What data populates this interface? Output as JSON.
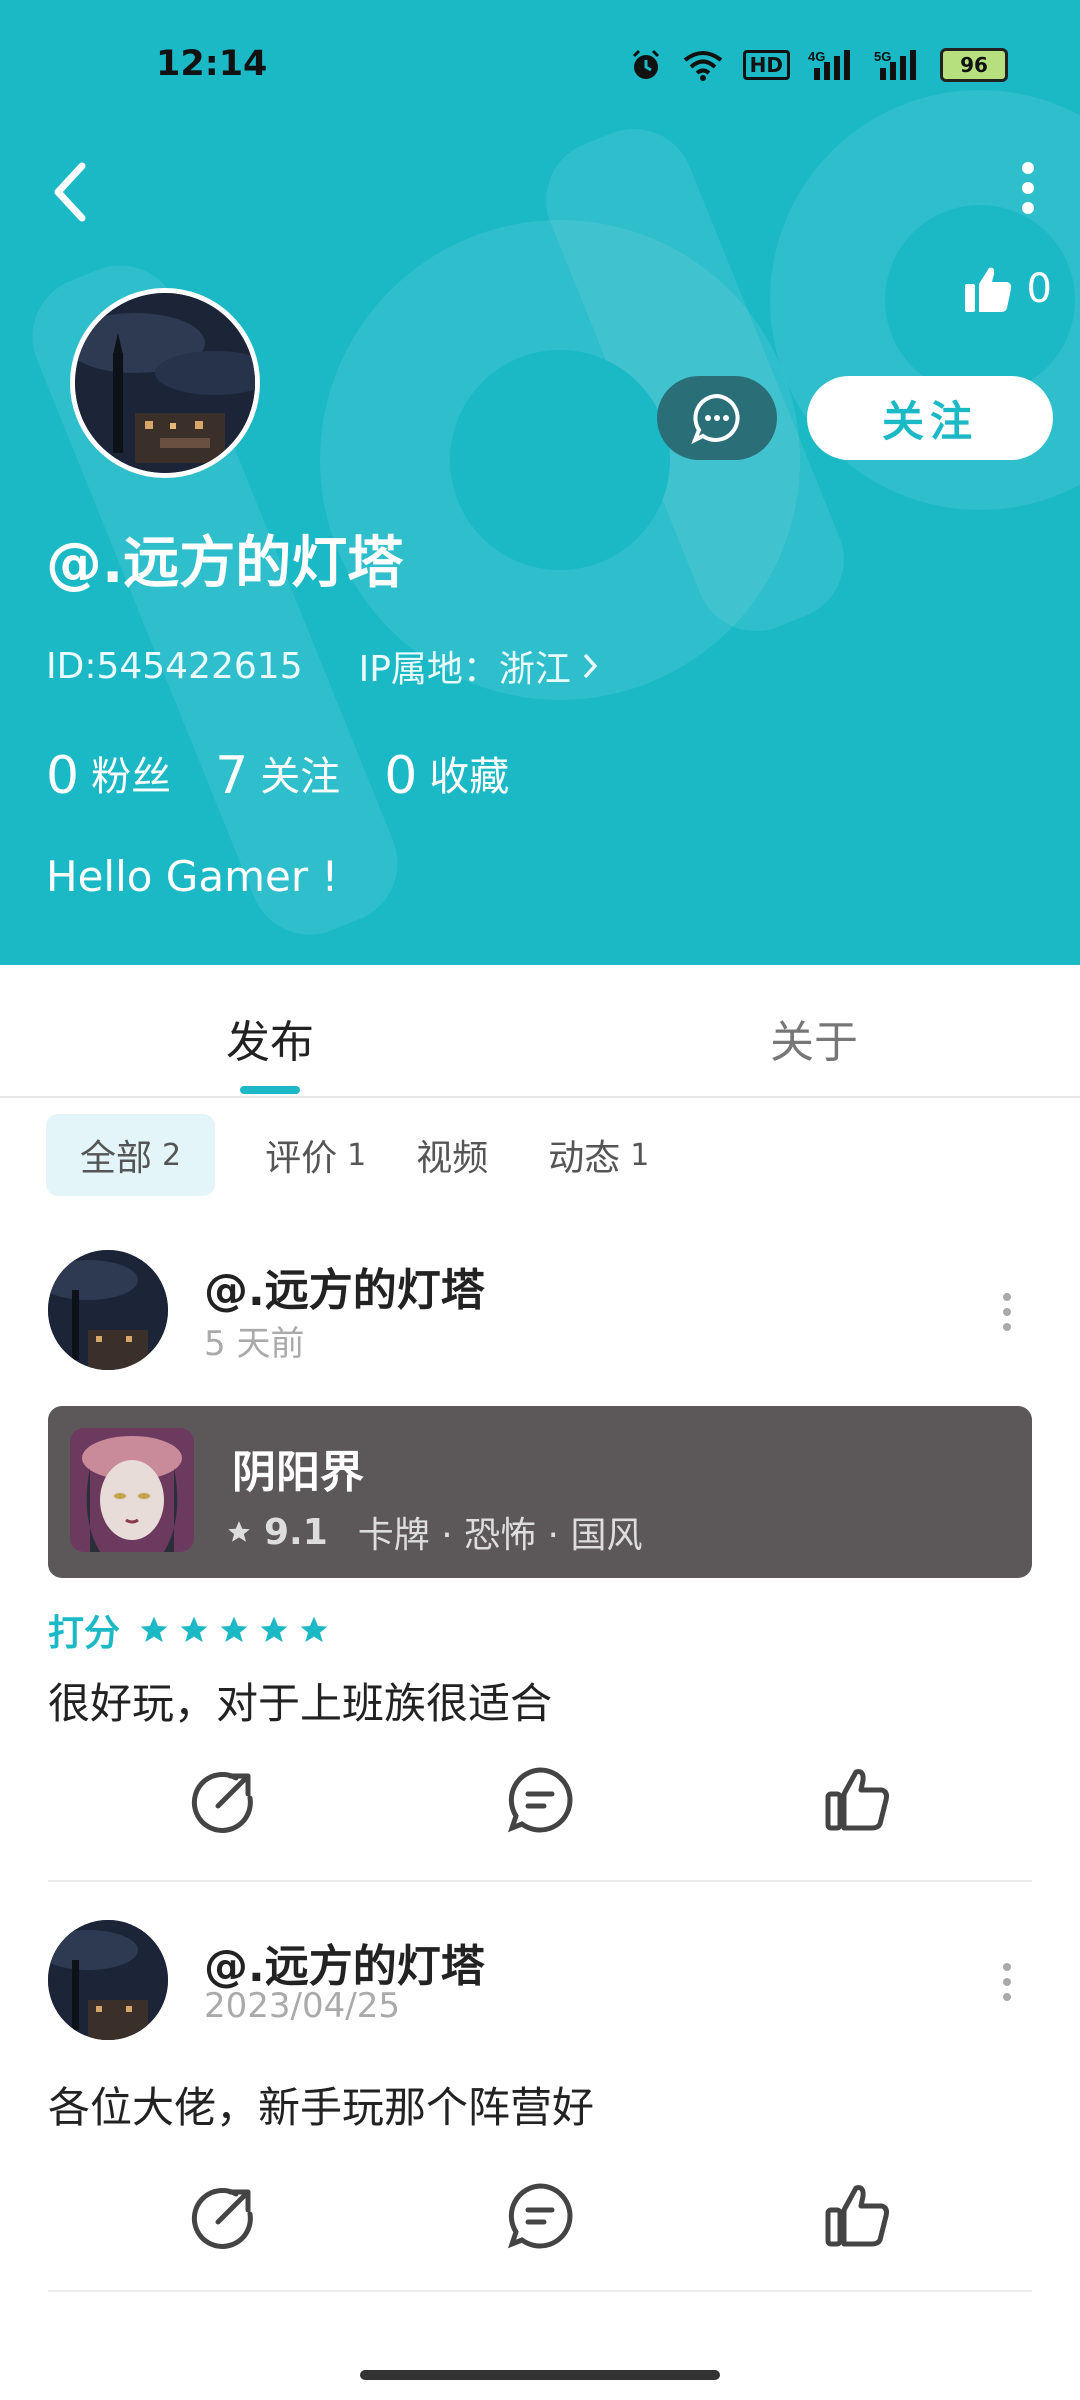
{
  "status_bar": {
    "time": "12:14",
    "icons": [
      "alarm-icon",
      "wifi-icon",
      "hd-icon",
      "4g-signal-icon",
      "5g-signal-icon",
      "battery-icon"
    ],
    "hd": "HD",
    "battery": "96"
  },
  "header": {
    "like_count": "0",
    "follow_label": "关注",
    "nickname": "@.远方的灯塔",
    "id_text": "ID:545422615",
    "ip_text": "IP属地：浙江",
    "bio": "Hello Gamer !",
    "stats": [
      {
        "num": "0",
        "label": "粉丝"
      },
      {
        "num": "7",
        "label": "关注"
      },
      {
        "num": "0",
        "label": "收藏"
      }
    ],
    "colors": {
      "brand": "#1bb8c6",
      "dark_button": "#2a6f78"
    }
  },
  "tabs": {
    "posts": "发布",
    "about": "关于"
  },
  "filters": [
    {
      "label": "全部",
      "count": "2"
    },
    {
      "label": "评价",
      "count": "1"
    },
    {
      "label": "视频",
      "count": ""
    },
    {
      "label": "动态",
      "count": "1"
    }
  ],
  "posts": [
    {
      "author": "@.远方的灯塔",
      "time": "5 天前",
      "game": {
        "name": "阴阳界",
        "score": "9.1",
        "tags": "卡牌 · 恐怖 · 国风"
      },
      "rating_label": "打分",
      "stars": 5,
      "text": "很好玩，对于上班族很适合"
    },
    {
      "author": "@.远方的灯塔",
      "time": "2023/04/25",
      "text": "各位大佬，新手玩那个阵营好"
    }
  ]
}
